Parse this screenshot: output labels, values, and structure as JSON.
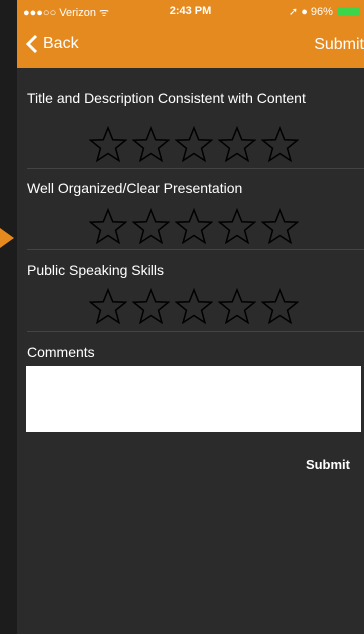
{
  "status_bar": {
    "carrier": "●●●○○ Verizon",
    "time": "2:43 PM",
    "battery": "96%"
  },
  "nav": {
    "back_label": "Back",
    "submit_label": "Submit"
  },
  "questions": [
    {
      "label": "Title and Description Consistent with Content",
      "rating": 0,
      "max": 5
    },
    {
      "label": "Well Organized/Clear Presentation",
      "rating": 0,
      "max": 5
    },
    {
      "label": "Public Speaking Skills",
      "rating": 0,
      "max": 5
    }
  ],
  "comments": {
    "label": "Comments",
    "value": ""
  },
  "footer": {
    "submit_label": "Submit"
  },
  "colors": {
    "accent": "#e58a1e",
    "background": "#2b2b2b",
    "battery": "#3dd64a"
  }
}
